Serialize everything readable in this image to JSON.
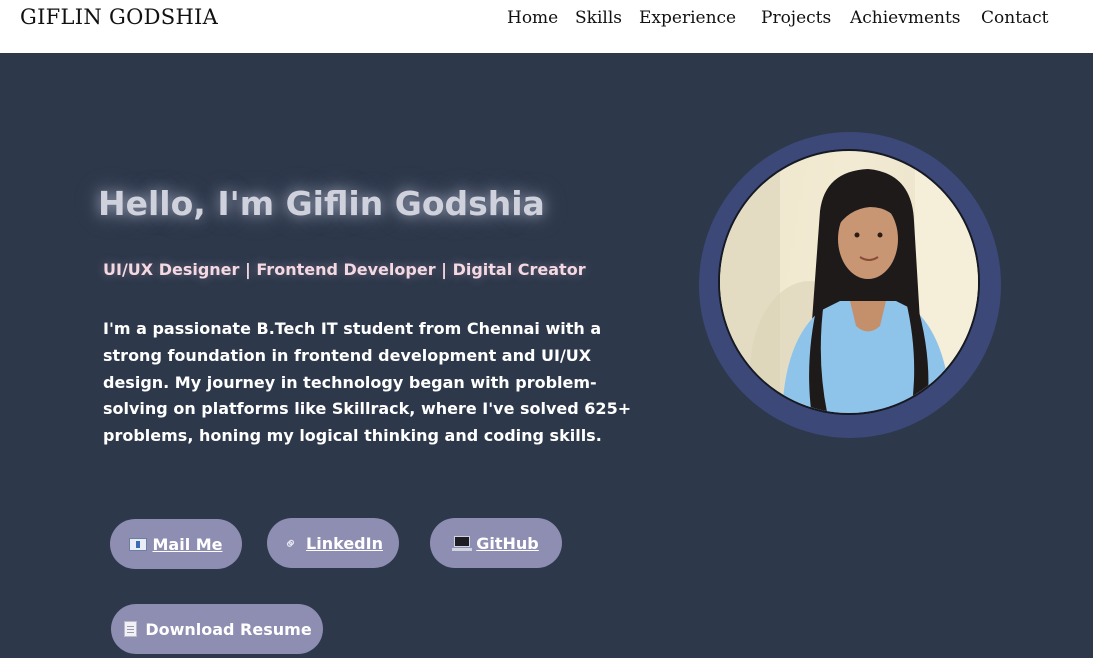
{
  "header": {
    "brand": "GIFLIN GODSHIA",
    "nav": [
      "Home",
      "Skills",
      "Experience",
      "Projects",
      "Achievments",
      "Contact"
    ]
  },
  "hero": {
    "title": "Hello, I'm Giflin Godshia",
    "subtitle": "UI/UX Designer | Frontend Developer | Digital Creator",
    "bio": "I'm a passionate B.Tech IT student from Chennai with a strong foundation in frontend development and UI/UX design. My journey in technology began with problem-solving on platforms like Skillrack, where I've solved 625+ problems, honing my logical thinking and coding skills."
  },
  "buttons": {
    "mail": {
      "label": "Mail Me",
      "icon": "email-icon"
    },
    "linkedin": {
      "label": "LinkedIn",
      "icon": "link-icon"
    },
    "github": {
      "label": "GitHub",
      "icon": "laptop-icon"
    },
    "resume": {
      "label": "Download Resume",
      "icon": "document-icon"
    }
  },
  "colors": {
    "background": "#2d384b",
    "navbar": "#ffffff",
    "button": "#8e8eb3",
    "avatar_ring": "#3c4878",
    "subtitle": "#f4d9e3"
  }
}
